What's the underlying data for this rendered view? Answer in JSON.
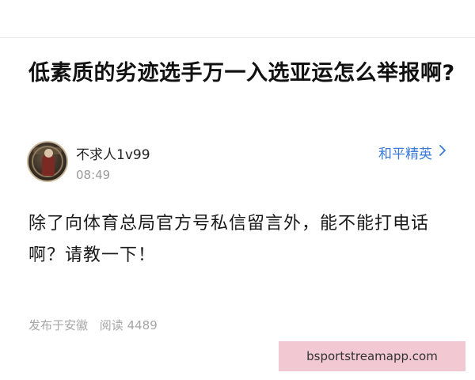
{
  "post": {
    "title": "低素质的劣迹选手万一入选亚运怎么举报啊?",
    "author": {
      "name": "不求人1v99",
      "time": "08:49"
    },
    "channel": {
      "label": "和平精英",
      "icon": "chevron-right-icon"
    },
    "body": "除了向体育总局官方号私信留言外，能不能打电话啊？请教一下！",
    "meta": {
      "location": "发布于安徽",
      "reads": "阅读 4489"
    }
  },
  "watermark": {
    "text": "bsportstreamapp.com"
  },
  "colors": {
    "accent": "#3a7ad8",
    "muted": "#9a9a9a",
    "watermark_bg": "#f2c9d3"
  }
}
